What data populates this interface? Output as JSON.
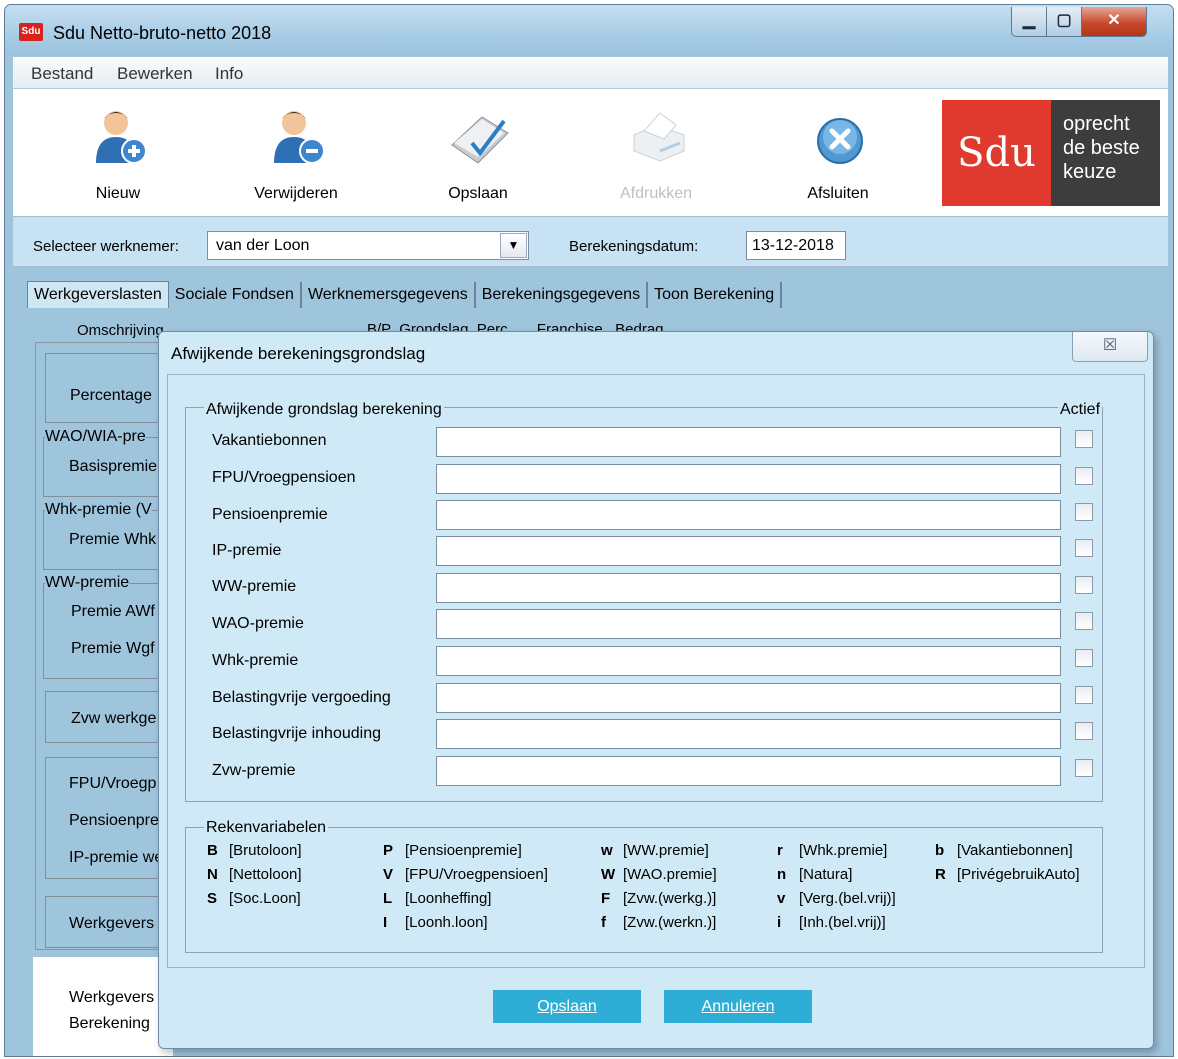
{
  "window": {
    "title": "Sdu Netto-bruto-netto 2018",
    "app_icon_text": "Sdu",
    "min_glyph": "▁",
    "max_glyph": "▢",
    "close_glyph": "✕"
  },
  "menu": [
    "Bestand",
    "Bewerken",
    "Info"
  ],
  "toolbar": {
    "new_label": "Nieuw",
    "delete_label": "Verwijderen",
    "save_label": "Opslaan",
    "print_label": "Afdrukken",
    "close_label": "Afsluiten"
  },
  "logo": {
    "brand": "Sdu",
    "tagline": [
      "oprecht",
      "de beste",
      "keuze"
    ]
  },
  "selection": {
    "employee_label": "Selecteer werknemer:",
    "employee_value": "van der Loon",
    "date_label": "Berekeningsdatum:",
    "date_value": "13-12-2018"
  },
  "tabs": [
    "Werkgeverslasten",
    "Sociale Fondsen",
    "Werknemersgegevens",
    "Berekeningsgegevens",
    "Toon Berekening"
  ],
  "grid_headers": {
    "omschrijving": "Omschrijving",
    "cols": "B/P  Grondslag  Perc.      Franchise   Bedrag"
  },
  "background_labels": {
    "percentage": "Percentage",
    "wao_group": "WAO/WIA-pre",
    "basispremie": "Basispremie",
    "whk_group": "Whk-premie (V",
    "premie_whk": "Premie Whk",
    "ww_group": "WW-premie",
    "premie_awf": "Premie AWf",
    "premie_wgf": "Premie Wgf",
    "zvw": "Zvw werkge",
    "fpu": "FPU/Vroegp",
    "pensioen": "Pensioenpre",
    "ip": "IP-premie we",
    "werkgevers1": "Werkgevers",
    "werkgevers2": "Werkgevers",
    "berekening": "Berekening"
  },
  "dialog": {
    "title": "Afwijkende berekeningsgrondslag",
    "close_glyph": "☒",
    "group_title": "Afwijkende grondslag berekening",
    "actief_label": "Actief",
    "rows": [
      {
        "label": "Vakantiebonnen",
        "value": "",
        "active": false
      },
      {
        "label": "FPU/Vroegpensioen",
        "value": "",
        "active": false
      },
      {
        "label": "Pensioenpremie",
        "value": "",
        "active": false
      },
      {
        "label": "IP-premie",
        "value": "",
        "active": false
      },
      {
        "label": "WW-premie",
        "value": "",
        "active": false
      },
      {
        "label": "WAO-premie",
        "value": "",
        "active": false
      },
      {
        "label": "Whk-premie",
        "value": "",
        "active": false
      },
      {
        "label": "Belastingvrije vergoeding",
        "value": "",
        "active": false
      },
      {
        "label": "Belastingvrije inhouding",
        "value": "",
        "active": false
      },
      {
        "label": "Zvw-premie",
        "value": "",
        "active": false
      }
    ],
    "variables_title": "Rekenvariabelen",
    "variables": [
      [
        {
          "key": "B",
          "desc": "[Brutoloon]"
        },
        {
          "key": "N",
          "desc": "[Nettoloon]"
        },
        {
          "key": "S",
          "desc": "[Soc.Loon]"
        }
      ],
      [
        {
          "key": "P",
          "desc": "[Pensioenpremie]"
        },
        {
          "key": "V",
          "desc": "[FPU/Vroegpensioen]"
        },
        {
          "key": "L",
          "desc": "[Loonheffing]"
        },
        {
          "key": "I",
          "desc": "[Loonh.loon]"
        }
      ],
      [
        {
          "key": "w",
          "desc": "[WW.premie]"
        },
        {
          "key": "W",
          "desc": "[WAO.premie]"
        },
        {
          "key": "F",
          "desc": "[Zvw.(werkg.)]"
        },
        {
          "key": "f",
          "desc": "[Zvw.(werkn.)]"
        }
      ],
      [
        {
          "key": "r",
          "desc": "[Whk.premie]"
        },
        {
          "key": "n",
          "desc": "[Natura]"
        },
        {
          "key": "v",
          "desc": "[Verg.(bel.vrij)]"
        },
        {
          "key": "i",
          "desc": "[Inh.(bel.vrij)]"
        }
      ],
      [
        {
          "key": "b",
          "desc": "[Vakantiebonnen]"
        },
        {
          "key": "R",
          "desc": "[PrivégebruikAuto]"
        }
      ]
    ],
    "save_label": "Opslaan",
    "cancel_label": "Annuleren"
  },
  "colors": {
    "accent": "#2eaed6",
    "brand_red": "#e03a2e",
    "brand_grey": "#3d3d3d",
    "panel": "#cfe9f6"
  }
}
